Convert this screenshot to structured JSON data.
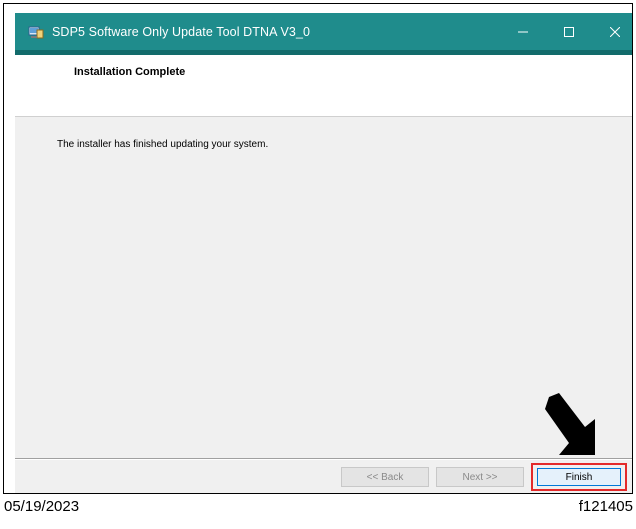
{
  "window": {
    "title": "SDP5 Software Only Update Tool DTNA V3_0",
    "app_icon": "installer-icon",
    "controls": [
      "minimize-icon",
      "maximize-icon",
      "close-icon"
    ]
  },
  "header": {
    "heading": "Installation Complete"
  },
  "content": {
    "message": "The installer has finished updating your system."
  },
  "buttons": {
    "back": "<< Back",
    "next": "Next >>",
    "finish": "Finish"
  },
  "annotations": {
    "arrow_icon": "down-arrow-icon",
    "highlight_color": "#e32a2a"
  },
  "caption": {
    "date": "05/19/2023",
    "figure_id": "f121405"
  },
  "colors": {
    "titlebar": "#1f8c8c",
    "accent": "#126b6b",
    "focus": "#0078d7"
  }
}
